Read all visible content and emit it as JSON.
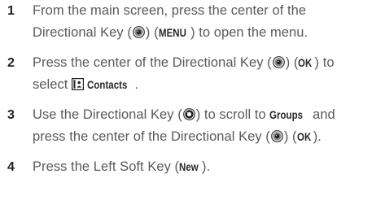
{
  "steps": [
    {
      "number": "1",
      "line1": {
        "t1": "From the main screen, press the center of the"
      },
      "line2": {
        "t1": "Directional Key (",
        "t2": ") (",
        "kw1": "MENU",
        "t3": ") to open the menu."
      }
    },
    {
      "number": "2",
      "line1": {
        "t1": "Press the center of the Directional Key (",
        "t2": ") (",
        "kw1": "OK",
        "t3": ") to"
      },
      "line2": {
        "t1": "select ",
        "kw1": "Contacts",
        "t2": "."
      }
    },
    {
      "number": "3",
      "line1": {
        "t1": "Use the Directional Key (",
        "t2": ") to scroll to ",
        "kw1": "Groups",
        "t3": " and"
      },
      "line2": {
        "t1": "press the center of the Directional Key (",
        "t2": ") (",
        "kw1": "OK",
        "t3": ")."
      }
    },
    {
      "number": "4",
      "line1": {
        "t1": "Press the Left Soft Key (",
        "kw1": "New",
        "t2": ")."
      }
    }
  ],
  "icons": {
    "directional_key_center": "directional-key-center-icon",
    "directional_key_scroll": "directional-key-scroll-icon",
    "contacts": "contacts-icon"
  }
}
